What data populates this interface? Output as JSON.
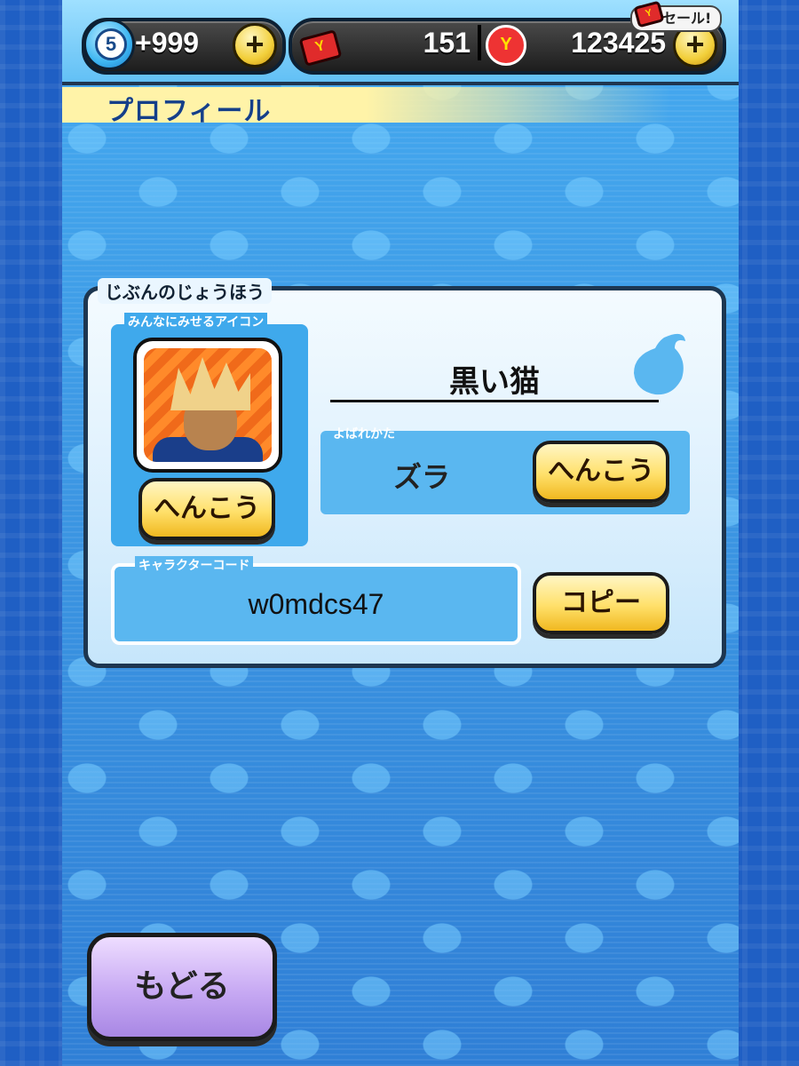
{
  "hud": {
    "spirit_level": "5",
    "spirit_count": "+999",
    "card_count": "151",
    "coin_count": "123425",
    "sale_label": "セール!",
    "icons": {
      "spirit": "spirit-orb-icon",
      "card": "y-card-icon",
      "coin": "y-coin-icon",
      "plus": "plus-icon"
    }
  },
  "header": {
    "title": "プロフィール"
  },
  "profile": {
    "section_label": "じぶんのじょうほう",
    "icon_label": "みんなにみせるアイコン",
    "icon_change_button": "へんこう",
    "player_name": "黒い猫",
    "nickname_label": "よばれかた",
    "nickname_value": "ズラ",
    "nickname_change_button": "へんこう",
    "character_code_label": "キャラクターコード",
    "character_code": "w0mdcs47",
    "copy_button": "コピー"
  },
  "footer": {
    "back_button": "もどる"
  },
  "colors": {
    "screen_blue": "#3d9ee8",
    "button_yellow": "#ffe06a",
    "button_purple": "#c7a9f3",
    "title_navy": "#153f88"
  }
}
